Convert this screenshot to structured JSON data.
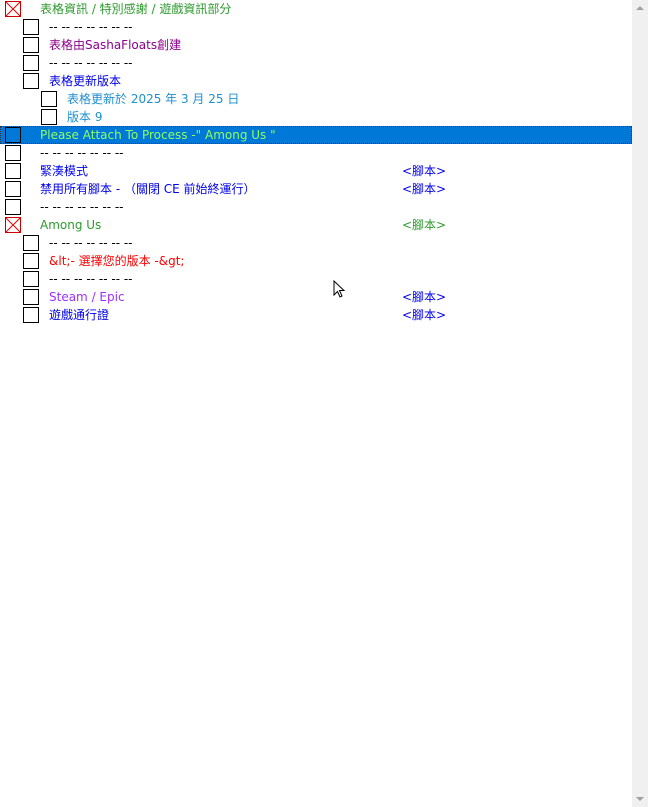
{
  "rows": [
    {
      "level": 0,
      "checked": true,
      "text": "表格資訊 / 特別感謝 / 遊戲資訊部分",
      "color": "#2e9a2e",
      "script": ""
    },
    {
      "level": 1,
      "checked": false,
      "text": "-- -- -- -- -- -- --",
      "color": "#000000",
      "script": ""
    },
    {
      "level": 1,
      "checked": false,
      "text": "表格由SashaFloats創建",
      "color": "#8b008b",
      "script": ""
    },
    {
      "level": 1,
      "checked": false,
      "text": "-- -- -- -- -- -- --",
      "color": "#000000",
      "script": ""
    },
    {
      "level": 1,
      "checked": false,
      "text": "表格更新版本",
      "color": "#0000ee",
      "script": ""
    },
    {
      "level": 2,
      "checked": false,
      "text": "表格更新於 2025 年 3 月 25 日",
      "color": "#1e8fd0",
      "script": ""
    },
    {
      "level": 2,
      "checked": false,
      "text": "版本 9",
      "color": "#1e8fd0",
      "script": ""
    },
    {
      "level": 0,
      "checked": false,
      "selected": true,
      "text": "Please Attach To Process -\" Among Us \"",
      "color": "#90ff60",
      "script": ""
    },
    {
      "level": 0,
      "checked": false,
      "text": "-- -- -- -- -- -- --",
      "color": "#000000",
      "script": ""
    },
    {
      "level": 0,
      "checked": false,
      "text": "緊湊模式",
      "color": "#0000ee",
      "script": "<腳本>",
      "scriptColor": "#0000ee"
    },
    {
      "level": 0,
      "checked": false,
      "text": "禁用所有腳本 - （關閉 CE 前始終運行）",
      "color": "#0000ee",
      "script": "<腳本>",
      "scriptColor": "#0000ee"
    },
    {
      "level": 0,
      "checked": false,
      "text": "-- -- -- -- -- -- --",
      "color": "#000000",
      "script": ""
    },
    {
      "level": 0,
      "checked": true,
      "text": "Among Us",
      "color": "#2e9a2e",
      "script": "<腳本>",
      "scriptColor": "#2e9a2e"
    },
    {
      "level": 1,
      "checked": false,
      "text": "-- -- -- -- -- -- --",
      "color": "#000000",
      "script": ""
    },
    {
      "level": 1,
      "checked": false,
      "text": "&lt;- 選擇您的版本 -&gt;",
      "color": "#ff0000",
      "script": ""
    },
    {
      "level": 1,
      "checked": false,
      "text": "-- -- -- -- -- -- --",
      "color": "#000000",
      "script": ""
    },
    {
      "level": 1,
      "checked": false,
      "text": "Steam / Epic",
      "color": "#9b30ff",
      "script": "<腳本>",
      "scriptColor": "#0000ee"
    },
    {
      "level": 1,
      "checked": false,
      "text": "遊戲通行證",
      "color": "#0000ee",
      "script": "<腳本>",
      "scriptColor": "#0000ee"
    }
  ]
}
